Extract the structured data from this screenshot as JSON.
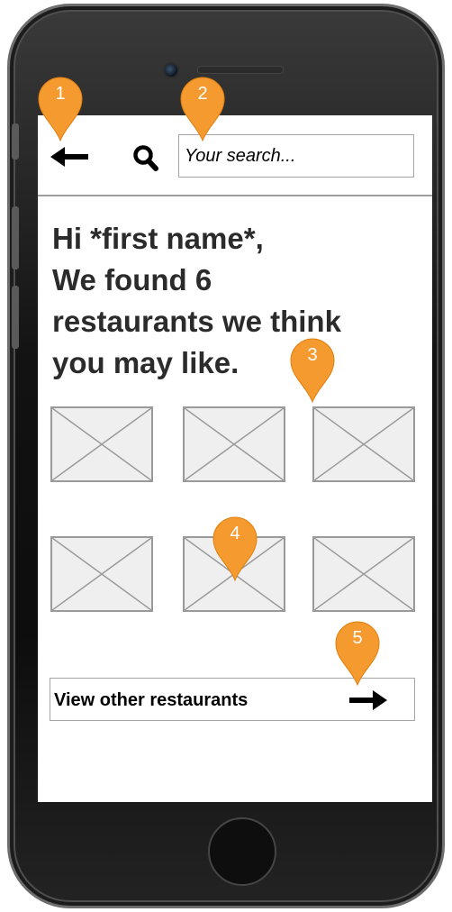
{
  "colors": {
    "marker_fill": "#f59a2f",
    "screen_bg": "#ffffff",
    "phone_body": "#1a1a1a",
    "placeholder_fill": "#efefef",
    "placeholder_stroke": "#9a9a9a",
    "heading_text": "#2b2b2b"
  },
  "topbar": {
    "back_icon": "arrow-left-icon",
    "search_icon": "magnifier-icon",
    "search_placeholder": "Your search..."
  },
  "greeting": {
    "lines": [
      "Hi *first name*,",
      "We found 6",
      "restaurants we think",
      "you may like."
    ]
  },
  "restaurants": {
    "count": 6,
    "image_icon": "image-placeholder-icon"
  },
  "view_other": {
    "label": "View other restaurants",
    "arrow_icon": "arrow-right-icon"
  },
  "markers": [
    "1",
    "2",
    "3",
    "4",
    "5"
  ]
}
